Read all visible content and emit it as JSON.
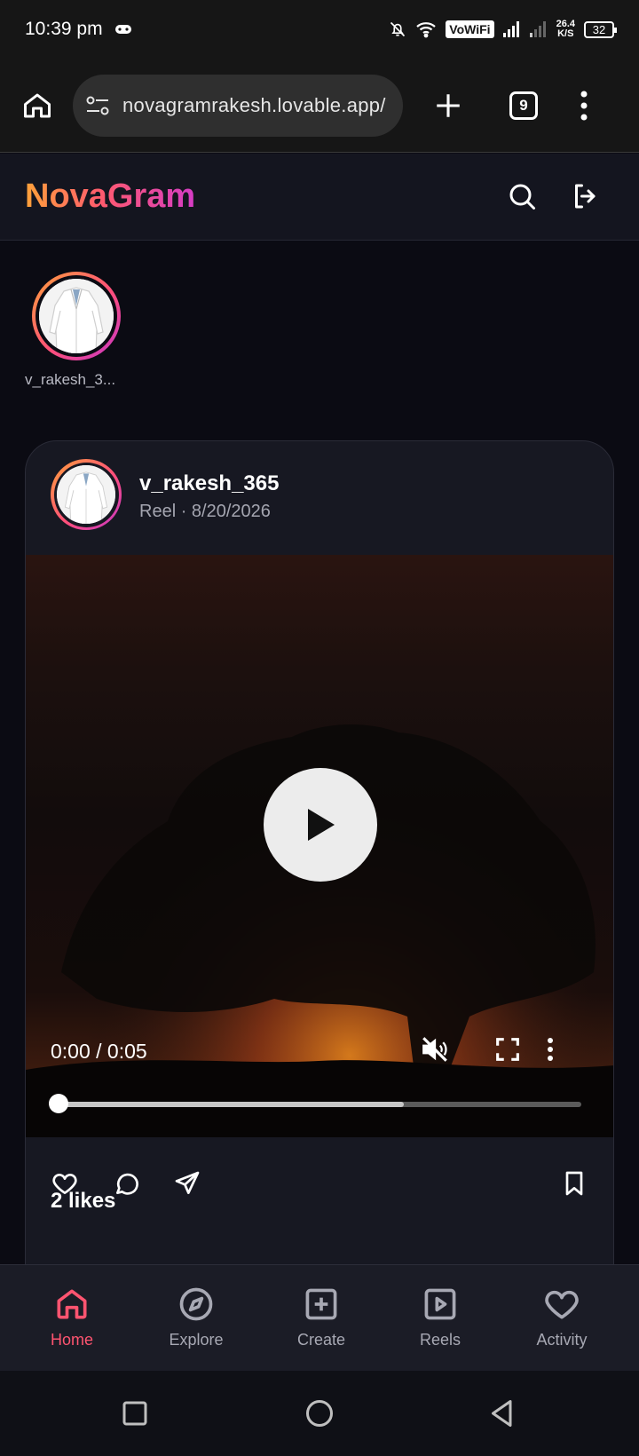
{
  "status_bar": {
    "time": "10:39 pm",
    "vowifi": "VoWiFi",
    "net_speed_value": "26.4",
    "net_speed_unit": "K/S",
    "battery": "32"
  },
  "browser": {
    "url": "novagramrakesh.lovable.app/",
    "tab_count": "9"
  },
  "app": {
    "brand": "NovaGram",
    "brand_gradient": [
      "#ffa23a",
      "#ff5a6e",
      "#d63cc6"
    ]
  },
  "stories": [
    {
      "username": "v_rakesh_3..."
    }
  ],
  "post": {
    "username": "v_rakesh_365",
    "meta": "Reel · 8/20/2026",
    "video": {
      "time": "0:00 / 0:05",
      "progress": 0.0,
      "buffered": 0.66,
      "muted": true
    },
    "likes": "2 likes"
  },
  "bottom_nav": {
    "active": "Home",
    "active_color": "#ff5470",
    "items": [
      {
        "label": "Home",
        "icon": "home-icon"
      },
      {
        "label": "Explore",
        "icon": "compass-icon"
      },
      {
        "label": "Create",
        "icon": "plus-square-icon"
      },
      {
        "label": "Reels",
        "icon": "play-square-icon"
      },
      {
        "label": "Activity",
        "icon": "heart-icon"
      }
    ]
  }
}
